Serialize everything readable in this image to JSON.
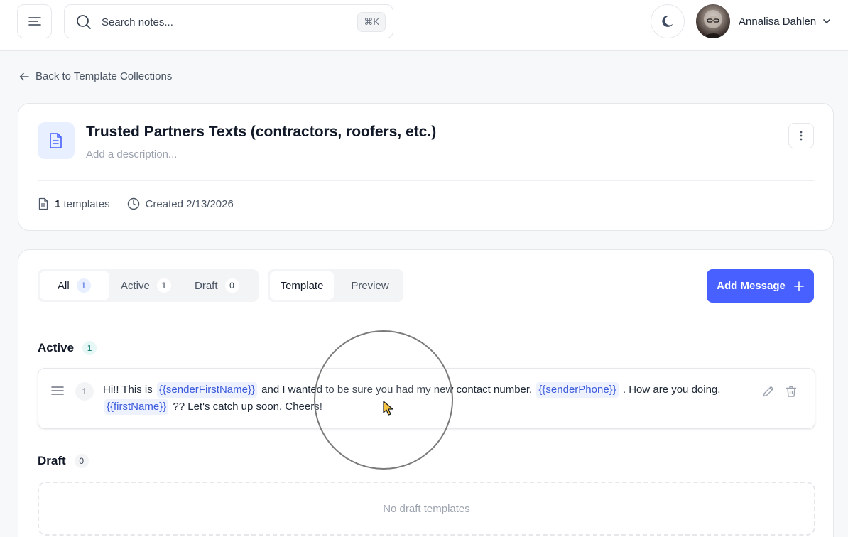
{
  "topbar": {
    "search": {
      "placeholder": "Search notes...",
      "shortcut": "⌘K"
    },
    "user": {
      "name": "Annalisa Dahlen"
    }
  },
  "nav": {
    "back_label": "Back to Template Collections"
  },
  "collection": {
    "title": "Trusted Partners Texts (contractors, roofers, etc.)",
    "description_placeholder": "Add a description...",
    "template_count": "1",
    "template_count_suffix": "templates",
    "created": "Created 2/13/2026"
  },
  "filters": {
    "status_tabs": [
      {
        "label": "All",
        "count": "1"
      },
      {
        "label": "Active",
        "count": "1"
      },
      {
        "label": "Draft",
        "count": "0"
      }
    ],
    "view_tabs": [
      {
        "label": "Template"
      },
      {
        "label": "Preview"
      }
    ],
    "add_label": "Add Message"
  },
  "sections": {
    "active": {
      "label": "Active",
      "count": "1"
    },
    "draft": {
      "label": "Draft",
      "count": "0",
      "empty_text": "No draft templates"
    }
  },
  "templates": [
    {
      "number": "1",
      "parts": [
        "Hi!! This is",
        "{{senderFirstName}}",
        "and I wanted to be sure you had my new contact number,",
        "{{senderPhone}}",
        ". How are you doing,",
        "{{firstName}}",
        "?? Let's catch up soon. Cheers!"
      ]
    }
  ],
  "colors": {
    "accent": "#4760ff",
    "variable_chip_bg": "#eef2ff",
    "variable_chip_text": "#3b5bdb",
    "active_badge_bg": "#e6f7f5"
  },
  "icons": [
    "menu-icon",
    "search-icon",
    "moon-icon",
    "chevron-down-icon",
    "arrow-left-icon",
    "document-icon",
    "kebab-icon",
    "clock-icon",
    "plus-icon",
    "drag-handle-icon",
    "pencil-icon",
    "trash-icon",
    "cursor-icon"
  ]
}
